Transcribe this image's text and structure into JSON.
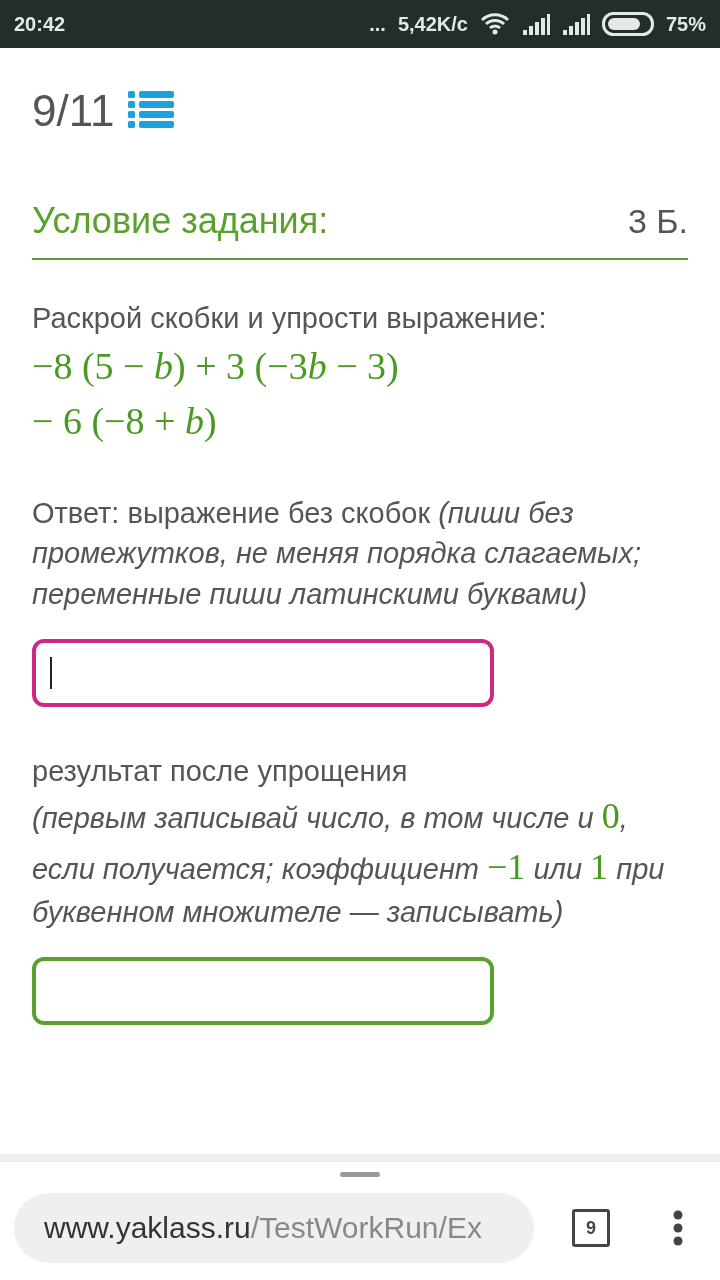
{
  "status_bar": {
    "time": "20:42",
    "dots": "...",
    "speed": "5,42K/с",
    "battery": "75%"
  },
  "header": {
    "progress": "9/11"
  },
  "section": {
    "title": "Условие задания:",
    "points": "3 Б."
  },
  "task": {
    "prompt": "Раскрой скобки и упрости выражение:",
    "math_lines": [
      [
        {
          "kind": "text",
          "text": "−8 (5 − "
        },
        {
          "kind": "var",
          "text": "b"
        },
        {
          "kind": "text",
          "text": ") + 3 (−3"
        },
        {
          "kind": "var",
          "text": "b"
        },
        {
          "kind": "text",
          "text": " − 3)"
        }
      ],
      [
        {
          "kind": "text",
          "text": "− 6 (−8 + "
        },
        {
          "kind": "var",
          "text": "b"
        },
        {
          "kind": "text",
          "text": ")"
        }
      ]
    ]
  },
  "answers": [
    {
      "intro": "Ответ: выражение без скобок",
      "hint": [
        {
          "kind": "text",
          "text": "(пиши без промежутков, не меняя порядка слагаемых; переменные пиши латинскими буквами)"
        }
      ],
      "focused": true
    },
    {
      "intro": "результат после упрощения",
      "hint": [
        {
          "kind": "text",
          "text": "(первым записывай число, в том числе и "
        },
        {
          "kind": "math",
          "text": "0"
        },
        {
          "kind": "text",
          "text": ", если получается; коэффициент "
        },
        {
          "kind": "math",
          "text": "−1"
        },
        {
          "kind": "text",
          "text": " или "
        },
        {
          "kind": "math",
          "text": "1"
        },
        {
          "kind": "text",
          "text": " при буквенном множителе — записывать)"
        }
      ],
      "focused": false
    }
  ],
  "browser": {
    "url_host": "www.yaklass.ru",
    "url_path": "/TestWorkRun/Ex",
    "tab_count": "9"
  }
}
